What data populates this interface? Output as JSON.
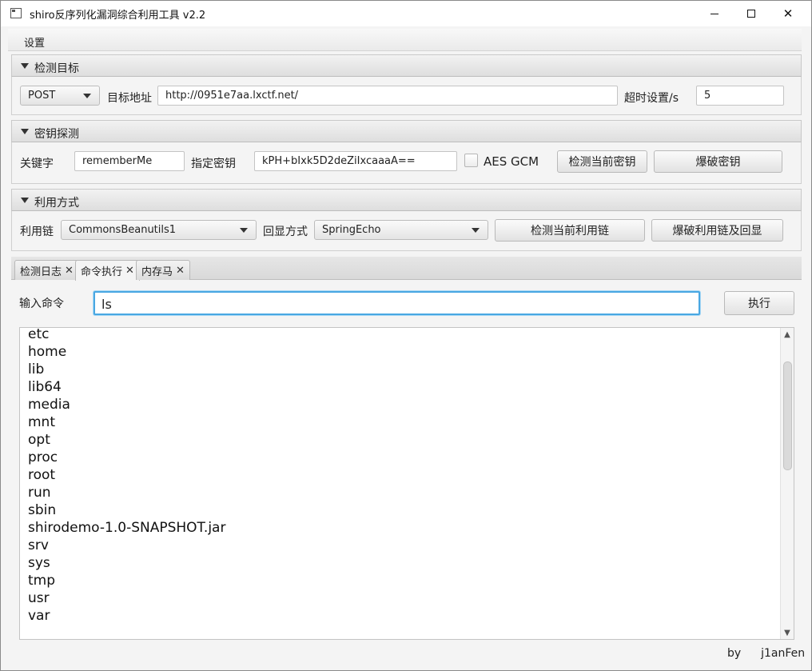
{
  "window": {
    "title": "shiro反序列化漏洞综合利用工具 v2.2",
    "minimize_label": "",
    "maximize_label": "",
    "close_label": "✕"
  },
  "menu": {
    "settings": "设置"
  },
  "target_section": {
    "title": "检测目标",
    "method": "POST",
    "url_label": "目标地址",
    "url_value": "http://0951e7aa.lxctf.net/",
    "timeout_label": "超时设置/s",
    "timeout_value": "5"
  },
  "key_section": {
    "title": "密钥探测",
    "keyword_label": "关键字",
    "keyword_value": "rememberMe",
    "key_label": "指定密钥",
    "key_value": "kPH+bIxk5D2deZiIxcaaaA==",
    "aes_gcm_label": "AES GCM",
    "aes_gcm_checked": false,
    "check_key_button": "检测当前密钥",
    "brute_key_button": "爆破密钥"
  },
  "exploit_section": {
    "title": "利用方式",
    "chain_label": "利用链",
    "chain_value": "CommonsBeanutils1",
    "echo_label": "回显方式",
    "echo_value": "SpringEcho",
    "check_chain_button": "检测当前利用链",
    "brute_chain_button": "爆破利用链及回显"
  },
  "tabs": [
    {
      "label": "检测日志",
      "active": false
    },
    {
      "label": "命令执行",
      "active": true
    },
    {
      "label": "内存马",
      "active": false
    }
  ],
  "command": {
    "label": "输入命令",
    "value": "ls",
    "execute_button": "执行"
  },
  "output_lines": [
    "etc",
    "home",
    "lib",
    "lib64",
    "media",
    "mnt",
    "opt",
    "proc",
    "root",
    "run",
    "sbin",
    "shirodemo-1.0-SNAPSHOT.jar",
    "srv",
    "sys",
    "tmp",
    "usr",
    "var"
  ],
  "footer": {
    "by": "by",
    "author": "j1anFen"
  },
  "colors": {
    "focus": "#49a7e2",
    "window_bg": "#f4f4f4"
  }
}
